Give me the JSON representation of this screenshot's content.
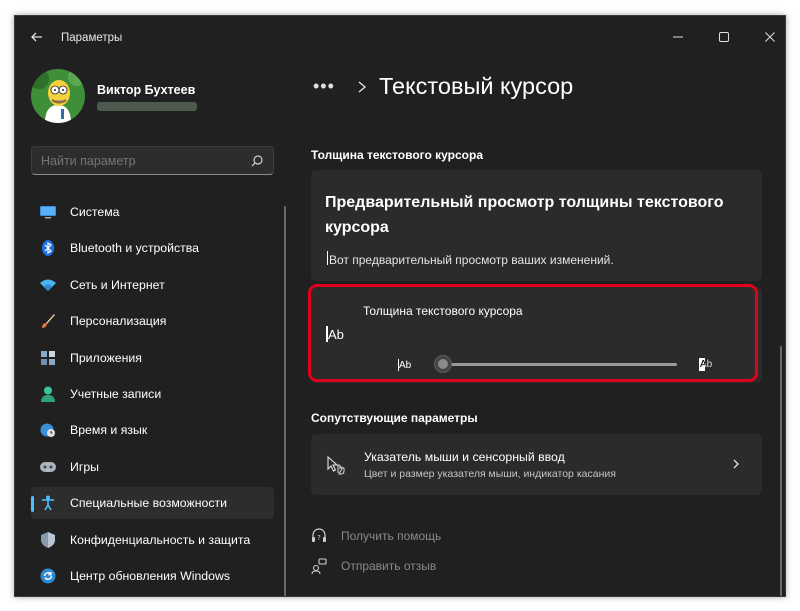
{
  "app": {
    "title": "Параметры"
  },
  "user": {
    "name": "Виктор Бухтеев"
  },
  "search": {
    "placeholder": "Найти параметр"
  },
  "sidebar": {
    "items": [
      {
        "label": "Система",
        "icon": "monitor-icon",
        "active": false
      },
      {
        "label": "Bluetooth и устройства",
        "icon": "bluetooth-icon",
        "active": false
      },
      {
        "label": "Сеть и Интернет",
        "icon": "wifi-icon",
        "active": false
      },
      {
        "label": "Персонализация",
        "icon": "brush-icon",
        "active": false
      },
      {
        "label": "Приложения",
        "icon": "apps-icon",
        "active": false
      },
      {
        "label": "Учетные записи",
        "icon": "person-icon",
        "active": false
      },
      {
        "label": "Время и язык",
        "icon": "globe-clock-icon",
        "active": false
      },
      {
        "label": "Игры",
        "icon": "gamepad-icon",
        "active": false
      },
      {
        "label": "Специальные возможности",
        "icon": "accessibility-icon",
        "active": true
      },
      {
        "label": "Конфиденциальность и защита",
        "icon": "shield-icon",
        "active": false
      },
      {
        "label": "Центр обновления Windows",
        "icon": "update-icon",
        "active": false
      }
    ]
  },
  "breadcrumb": {
    "dots": "•••",
    "title": "Текстовый курсор"
  },
  "main": {
    "section_title": "Толщина текстового курсора",
    "preview_title": "Предварительный просмотр толщины текстового курсора",
    "preview_text": "Вот предварительный просмотр ваших изменений.",
    "thickness_label": "Толщина текстового курсора",
    "sample_text": "Ab",
    "slider_value": 0,
    "related_heading": "Сопутствующие параметры",
    "related_title": "Указатель мыши и сенсорный ввод",
    "related_subtitle": "Цвет и размер указателя мыши, индикатор касания",
    "help_link": "Получить помощь",
    "feedback_link": "Отправить отзыв"
  },
  "colors": {
    "accent": "#4cc2ff",
    "highlight": "#e0001b",
    "background": "#202020",
    "card": "#2b2b2b"
  }
}
